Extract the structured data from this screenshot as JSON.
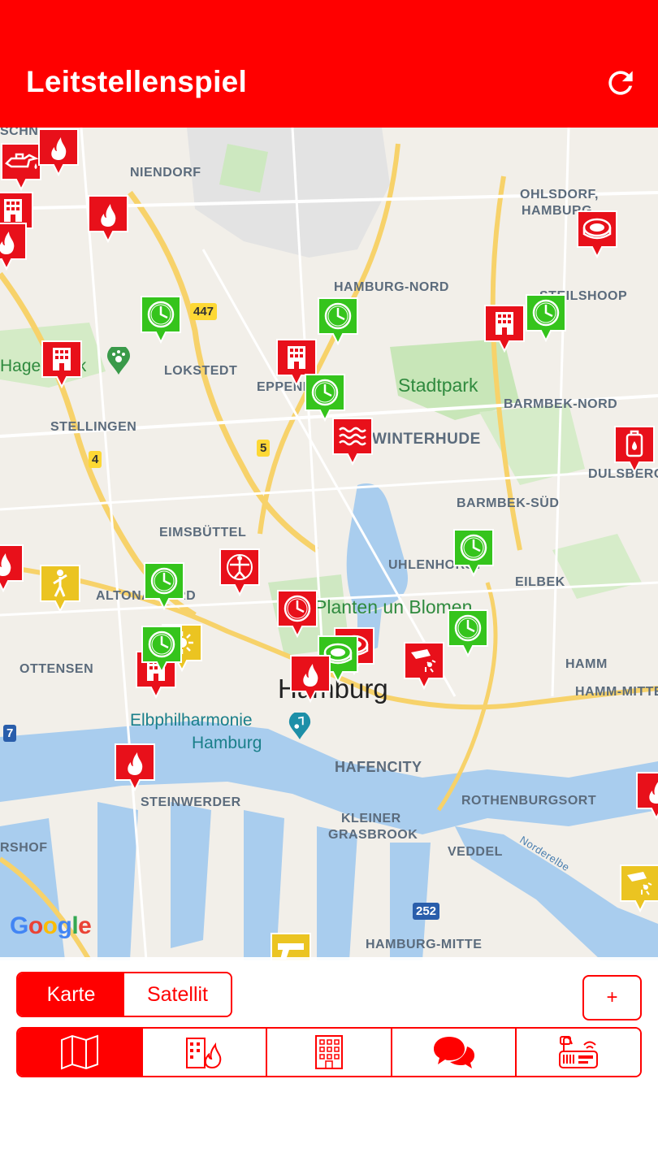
{
  "app": {
    "title": "Leitstellenspiel",
    "accent": "#ff0000"
  },
  "map": {
    "labels": {
      "niendorf": "NIENDORF",
      "ohlsdorf": "OHLSDORF,",
      "hamburg_sub": "HAMBURG",
      "hamburg_nord": "HAMBURG-NORD",
      "steilshoop": "STEILSHOOP",
      "hagenbeck": "Hagenbeck",
      "lokstedt": "LOKSTEDT",
      "eppendorf": "EPPENDORF",
      "stadtpark": "Stadtpark",
      "barmbek_nord": "BARMBEK-NORD",
      "stellingen": "STELLINGEN",
      "winterhude": "WINTERHUDE",
      "dulsberg": "DULSBERG",
      "barmbek_sued": "BARMBEK-SÜD",
      "eimsbuettel": "EIMSBÜTTEL",
      "uhlenhorst": "UHLENHORST",
      "eilbek": "EILBEK",
      "altona": "ALTONA-NORD",
      "planten": "Planten un Blomen",
      "ottensen": "OTTENSEN",
      "hamm": "HAMM",
      "hamm_mitte": "HAMM-MITTE",
      "hamburg": "Hamburg",
      "elbphil_1": "Elbphilharmonie",
      "elbphil_2": "Hamburg",
      "hafencity": "HAFENCITY",
      "steinwerder": "STEINWERDER",
      "rothenburgsort": "ROTHENBURGSORT",
      "rshof": "RSHOF",
      "kleiner_1": "KLEINER",
      "kleiner_2": "GRASBROOK",
      "veddel": "VEDDEL",
      "norderelbe": "Norderelbe",
      "hamburg_mitte": "HAMBURG-MITTE",
      "schnelsen": "SCHN"
    },
    "road_shields": {
      "r447": "447",
      "r4": "4",
      "r5": "5",
      "r7": "7",
      "r252": "252"
    },
    "attribution": {
      "g1": "G",
      "o1": "o",
      "o2": "o",
      "g2": "g",
      "l": "l",
      "e": "e"
    }
  },
  "marker_colors": {
    "red": "#e8101a",
    "green": "#35c41c",
    "yellow": "#ebc421"
  },
  "markers": [
    {
      "id": "m1",
      "color": "red",
      "icon": "oil-icon"
    },
    {
      "id": "m2",
      "color": "red",
      "icon": "fire-icon"
    },
    {
      "id": "m3",
      "color": "red",
      "icon": "building-icon"
    },
    {
      "id": "m4",
      "color": "red",
      "icon": "fire-icon"
    },
    {
      "id": "m5",
      "color": "red",
      "icon": "fire-icon"
    },
    {
      "id": "m6",
      "color": "red",
      "icon": "stadium-icon"
    },
    {
      "id": "m7",
      "color": "green",
      "icon": "clock-icon"
    },
    {
      "id": "m8",
      "color": "green",
      "icon": "clock-icon"
    },
    {
      "id": "m9",
      "color": "red",
      "icon": "building-icon"
    },
    {
      "id": "m10",
      "color": "green",
      "icon": "clock-icon"
    },
    {
      "id": "m11",
      "color": "red",
      "icon": "building-icon"
    },
    {
      "id": "m12",
      "color": "red",
      "icon": "building-icon"
    },
    {
      "id": "m13",
      "color": "green",
      "icon": "clock-icon"
    },
    {
      "id": "m14",
      "color": "red",
      "icon": "water-icon"
    },
    {
      "id": "m15",
      "color": "red",
      "icon": "canister-icon"
    },
    {
      "id": "m16",
      "color": "green",
      "icon": "clock-icon"
    },
    {
      "id": "m17",
      "color": "yellow",
      "icon": "person-icon"
    },
    {
      "id": "m18",
      "color": "green",
      "icon": "clock-icon"
    },
    {
      "id": "m19",
      "color": "red",
      "icon": "vitruvian-icon"
    },
    {
      "id": "m20",
      "color": "red",
      "icon": "clock-icon"
    },
    {
      "id": "m21",
      "color": "red",
      "icon": "stadium-icon"
    },
    {
      "id": "m22",
      "color": "green",
      "icon": "stadium-icon"
    },
    {
      "id": "m23",
      "color": "red",
      "icon": "hazard-icon"
    },
    {
      "id": "m24",
      "color": "green",
      "icon": "clock-icon"
    },
    {
      "id": "m25",
      "color": "yellow",
      "icon": "sun-icon"
    },
    {
      "id": "m26",
      "color": "red",
      "icon": "building-icon"
    },
    {
      "id": "m27",
      "color": "green",
      "icon": "clock-icon"
    },
    {
      "id": "m28",
      "color": "red",
      "icon": "fire-icon"
    },
    {
      "id": "m29",
      "color": "red",
      "icon": "fire-icon"
    },
    {
      "id": "m30",
      "color": "red",
      "icon": "fire-icon"
    },
    {
      "id": "m31",
      "color": "yellow",
      "icon": "hazard-icon"
    },
    {
      "id": "m32",
      "color": "yellow",
      "icon": "gun-icon"
    },
    {
      "id": "m33",
      "color": "red",
      "icon": "fire-icon"
    }
  ],
  "controls": {
    "map_type": {
      "karte": "Karte",
      "satellit": "Satellit",
      "selected": "Karte"
    },
    "add_label": "+"
  },
  "tabs": [
    {
      "icon": "map-icon",
      "active": true
    },
    {
      "icon": "building-fire-icon",
      "active": false
    },
    {
      "icon": "building-icon",
      "active": false
    },
    {
      "icon": "chat-icon",
      "active": false
    },
    {
      "icon": "radio-icon",
      "active": false
    }
  ]
}
